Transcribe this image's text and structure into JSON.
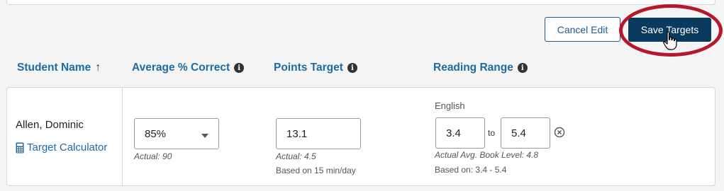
{
  "toolbar": {
    "cancel_label": "Cancel Edit",
    "save_label": "Save Targets"
  },
  "columns": {
    "student_name": "Student Name",
    "avg_correct": "Average % Correct",
    "points_target": "Points Target",
    "reading_range": "Reading Range"
  },
  "row": {
    "student_name": "Allen, Dominic",
    "calculator_link": "Target Calculator",
    "avg_correct": {
      "selected": "85%",
      "actual": "Actual: 90"
    },
    "points_target": {
      "value": "13.1",
      "actual": "Actual: 4.5",
      "basis": "Based on 15 min/day"
    },
    "reading_range": {
      "language": "English",
      "from": "3.4",
      "to_label": "to",
      "to": "5.4",
      "actual": "Actual Avg. Book Level: 4.8",
      "basis": "Based on: 3.4 - 5.4"
    }
  },
  "colors": {
    "accent": "#1f6aa5",
    "primary_button": "#0b3a5f",
    "highlight_ring": "#b5182b"
  },
  "icons": [
    "arrow-up-icon",
    "info-icon",
    "calculator-icon",
    "chevron-down-icon",
    "clear-circle-icon",
    "hand-cursor-icon"
  ]
}
